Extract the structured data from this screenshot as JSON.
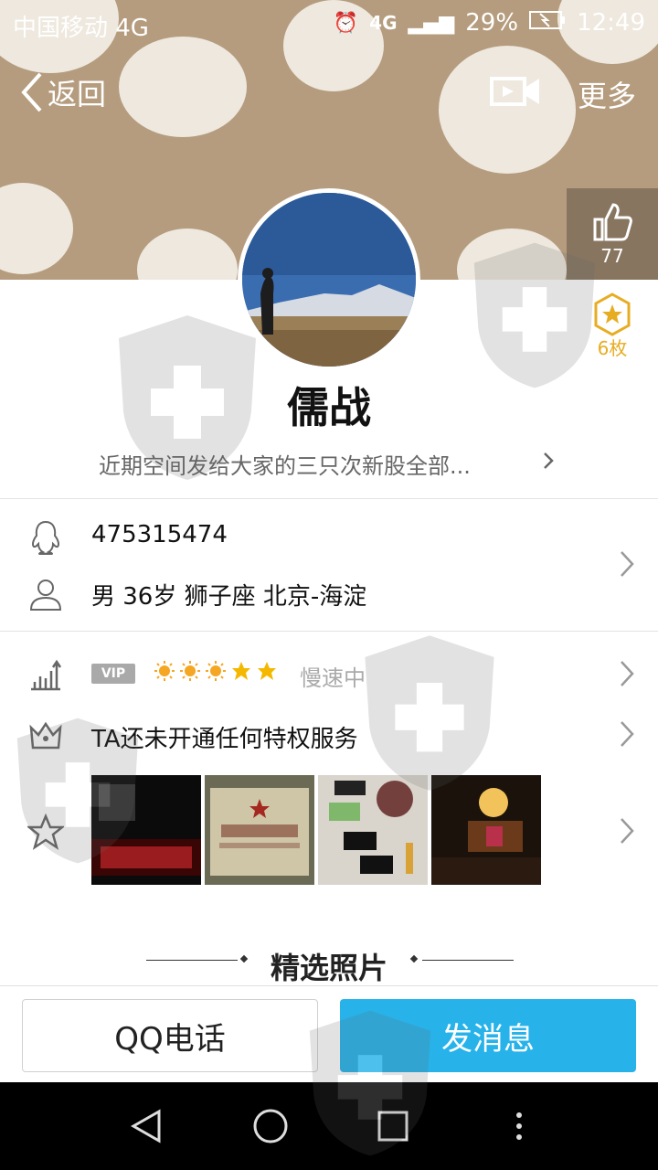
{
  "status_bar": {
    "carrier": "中国移动 4G",
    "network": "4G",
    "battery": "29%",
    "time": "12:49"
  },
  "nav": {
    "back_label": "返回",
    "more_label": "更多"
  },
  "side": {
    "like_count": "77",
    "badge_count": "6枚"
  },
  "profile": {
    "name": "儒战",
    "signature": "近期空间发给大家的三只次新股全部..."
  },
  "info": {
    "qq_number": "475315474",
    "details": "男  36岁  狮子座  北京-海淀"
  },
  "level": {
    "vip_tag": "VIP",
    "speed_text": "慢速中"
  },
  "privilege": {
    "text": "TA还未开通任何特权服务"
  },
  "photos_section": {
    "title": "精选照片"
  },
  "actions": {
    "call_label": "QQ电话",
    "message_label": "发消息"
  },
  "colors": {
    "accent": "#27b3ea",
    "badge": "#e7ad22",
    "cover": "#b59c7e"
  }
}
